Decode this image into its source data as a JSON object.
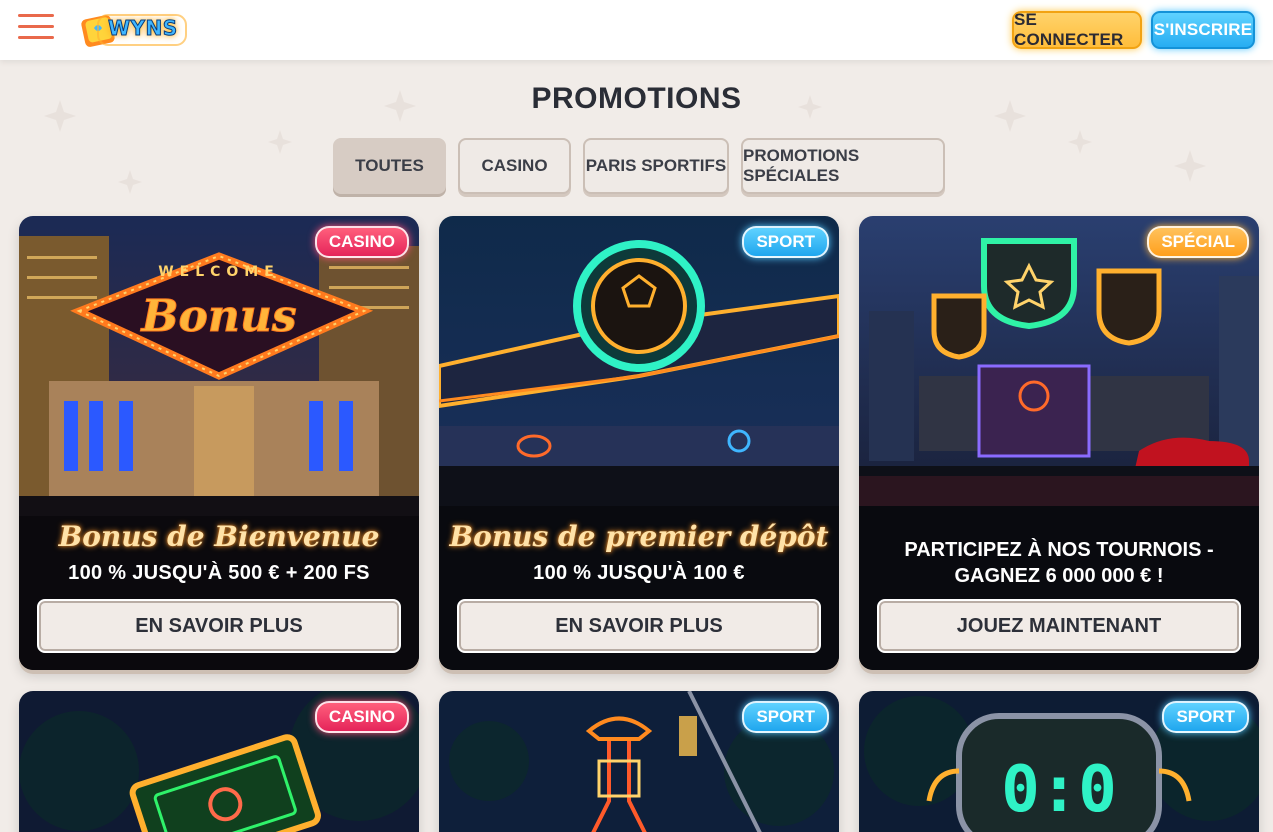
{
  "header": {
    "logo_text": "WYNS",
    "login_label": "SE CONNECTER",
    "signup_label": "S'INSCRIRE"
  },
  "page": {
    "title": "PROMOTIONS"
  },
  "tabs": [
    {
      "label": "TOUTES",
      "active": true
    },
    {
      "label": "CASINO",
      "active": false
    },
    {
      "label": "PARIS SPORTIFS",
      "active": false
    },
    {
      "label": "PROMOTIONS SPÉCIALES",
      "active": false
    }
  ],
  "promotions": [
    {
      "badge": "CASINO",
      "title": "Bonus de Bienvenue",
      "subtitle": "100 % JUSQU'À 500 € + 200 FS",
      "button": "EN SAVOIR PLUS",
      "art_text": "Bonus",
      "art_caption": "WELCOME"
    },
    {
      "badge": "SPORT",
      "title": "Bonus de premier dépôt",
      "subtitle": "100 % JUSQU'À 100 €",
      "button": "EN SAVOIR PLUS"
    },
    {
      "badge": "SPÉCIAL",
      "title": "PARTICIPEZ À NOS TOURNOIS -\nGAGNEZ 6 000 000 € !",
      "button": "JOUEZ MAINTENANT"
    },
    {
      "badge": "CASINO"
    },
    {
      "badge": "SPORT"
    },
    {
      "badge": "SPORT",
      "art_text": "0:0"
    }
  ],
  "colors": {
    "accent_orange": "#e9694b",
    "login_yellow": "#ffbd3b",
    "signup_blue": "#27adf2",
    "casino_pink": "#e5245a",
    "sport_blue": "#1fa6ee",
    "special_orange": "#ff9f1c"
  },
  "icons": {
    "menu": "hamburger-icon",
    "logo": "wyns-logo"
  }
}
